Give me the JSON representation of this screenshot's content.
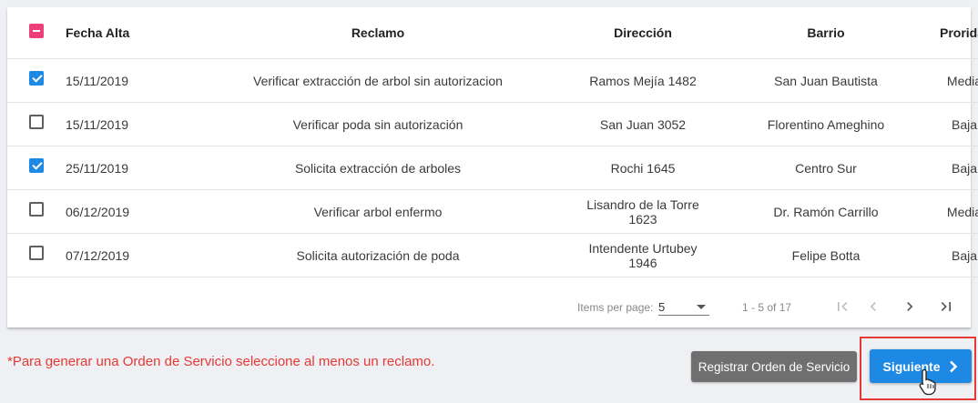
{
  "table": {
    "headers": {
      "fecha": "Fecha Alta",
      "reclamo": "Reclamo",
      "direccion": "Dirección",
      "barrio": "Barrio",
      "prioridad": "Proridad"
    },
    "rows": [
      {
        "checked": true,
        "fecha": "15/11/2019",
        "reclamo": "Verificar extracción de arbol sin autorizacion",
        "direccion": "Ramos Mejía 1482",
        "barrio": "San Juan Bautista",
        "prioridad": "Media"
      },
      {
        "checked": false,
        "fecha": "15/11/2019",
        "reclamo": "Verificar poda sin autorización",
        "direccion": "San Juan 3052",
        "barrio": "Florentino Ameghino",
        "prioridad": "Baja"
      },
      {
        "checked": true,
        "fecha": "25/11/2019",
        "reclamo": "Solicita extracción de arboles",
        "direccion": "Rochi 1645",
        "barrio": "Centro Sur",
        "prioridad": "Baja"
      },
      {
        "checked": false,
        "fecha": "06/12/2019",
        "reclamo": "Verificar arbol enfermo",
        "direccion": "Lisandro de la Torre 1623",
        "barrio": "Dr. Ramón Carrillo",
        "prioridad": "Media"
      },
      {
        "checked": false,
        "fecha": "07/12/2019",
        "reclamo": "Solicita autorización de poda",
        "direccion": "Intendente Urtubey 1946",
        "barrio": "Felipe Botta",
        "prioridad": "Baja"
      }
    ]
  },
  "paginator": {
    "items_per_page_label": "Items per page:",
    "page_size": "5",
    "range_label": "1 - 5 of 17"
  },
  "footer": {
    "warning": "*Para generar una Orden de Servicio seleccione al menos un reclamo.",
    "register_label": "Registrar Orden de Servicio",
    "next_label": "Siguiente"
  },
  "colors": {
    "accent": "#1e88e5",
    "indeterminate": "#ec407a",
    "warning": "#e53935",
    "secondary_button": "#6f6f6f"
  }
}
